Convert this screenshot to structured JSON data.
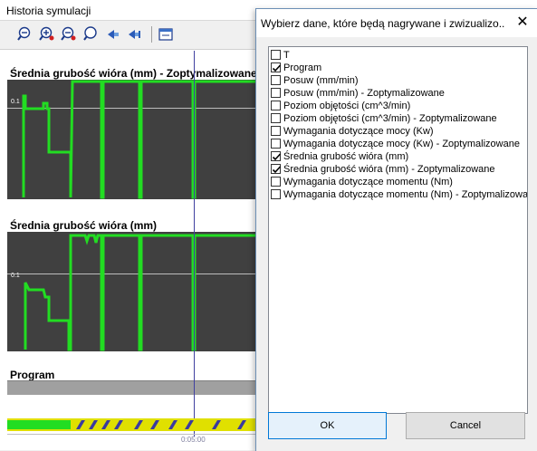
{
  "history_window": {
    "title": "Historia symulacji",
    "toolbar": {
      "icons": [
        "zoom-out-icon",
        "zoom-in-x-icon",
        "zoom-in-y-icon",
        "zoom-fit-icon",
        "step-back-icon",
        "step-forward-icon",
        "export-icon"
      ]
    },
    "charts": [
      {
        "label": "Średnia grubość wióra (mm) - Zoptymalizowane",
        "tick": "0.1"
      },
      {
        "label": "Średnia grubość wióra (mm)",
        "tick": "0.1"
      },
      {
        "label": "Program"
      }
    ],
    "time_label": "0:05:00",
    "colors": {
      "plot_bg": "#404040",
      "signal": "#22dd22",
      "timeline": "#e0e000",
      "cursor": "#4040a0"
    }
  },
  "dialog": {
    "title": "Wybierz dane, które będą nagrywane i zwizualizo...",
    "close_label": "✕",
    "items": [
      {
        "label": "T",
        "checked": false
      },
      {
        "label": "Program",
        "checked": true
      },
      {
        "label": "Posuw (mm/min)",
        "checked": false
      },
      {
        "label": "Posuw (mm/min) - Zoptymalizowane",
        "checked": false
      },
      {
        "label": "Poziom objętości (cm^3/min)",
        "checked": false
      },
      {
        "label": "Poziom objętości (cm^3/min) - Zoptymalizowane",
        "checked": false
      },
      {
        "label": "Wymagania dotyczące mocy (Kw)",
        "checked": false
      },
      {
        "label": "Wymagania dotyczące mocy (Kw) - Zoptymalizowane",
        "checked": false
      },
      {
        "label": "Średnia grubość wióra (mm)",
        "checked": true
      },
      {
        "label": "Średnia grubość wióra (mm) - Zoptymalizowane",
        "checked": true
      },
      {
        "label": "Wymagania dotyczące momentu (Nm)",
        "checked": false
      },
      {
        "label": "Wymagania dotyczące momentu (Nm) - Zoptymalizowane",
        "checked": false
      }
    ],
    "ok_label": "OK",
    "cancel_label": "Cancel"
  }
}
